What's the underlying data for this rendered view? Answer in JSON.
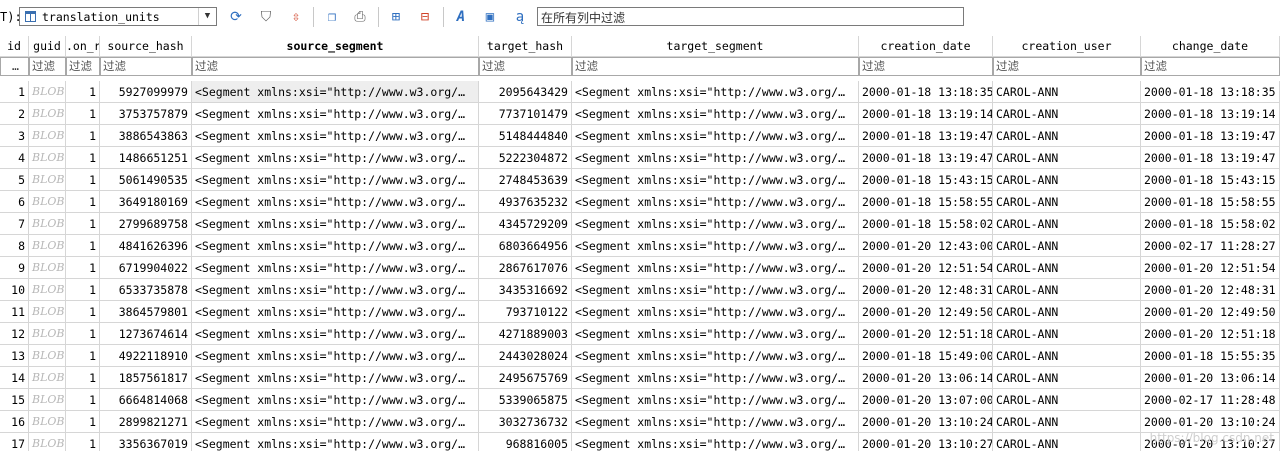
{
  "toolbar": {
    "table_prefix": "T):",
    "table_name": "translation_units",
    "icons": [
      "refresh-icon",
      "filter-icon",
      "clear-filter-icon",
      "copy-table-icon",
      "print-icon",
      "add-row-icon",
      "delete-row-icon",
      "text-format-icon",
      "open-icon",
      "translate-icon"
    ],
    "filter_all_placeholder": "在所有列中过滤"
  },
  "grid": {
    "columns": [
      "id",
      "guid",
      ".on_r",
      "source_hash",
      "source_segment",
      "target_hash",
      "target_segment",
      "creation_date",
      "creation_user",
      "change_date"
    ],
    "filter_placeholder": "过滤",
    "filter_first": "…",
    "rows": [
      {
        "id": "1",
        "guid": "BLOB",
        "on": "1",
        "source_hash": "5927099979",
        "source_segment": "<Segment xmlns:xsi=\"http://www.w3.org/…",
        "target_hash": "2095643429",
        "target_segment": "<Segment xmlns:xsi=\"http://www.w3.org/…",
        "creation_date": "2000-01-18 13:18:35",
        "creation_user": "CAROL-ANN",
        "change_date": "2000-01-18 13:18:35"
      },
      {
        "id": "2",
        "guid": "BLOB",
        "on": "1",
        "source_hash": "3753757879",
        "source_segment": "<Segment xmlns:xsi=\"http://www.w3.org/…",
        "target_hash": "7737101479",
        "target_segment": "<Segment xmlns:xsi=\"http://www.w3.org/…",
        "creation_date": "2000-01-18 13:19:14",
        "creation_user": "CAROL-ANN",
        "change_date": "2000-01-18 13:19:14"
      },
      {
        "id": "3",
        "guid": "BLOB",
        "on": "1",
        "source_hash": "3886543863",
        "source_segment": "<Segment xmlns:xsi=\"http://www.w3.org/…",
        "target_hash": "5148444840",
        "target_segment": "<Segment xmlns:xsi=\"http://www.w3.org/…",
        "creation_date": "2000-01-18 13:19:47",
        "creation_user": "CAROL-ANN",
        "change_date": "2000-01-18 13:19:47"
      },
      {
        "id": "4",
        "guid": "BLOB",
        "on": "1",
        "source_hash": "1486651251",
        "source_segment": "<Segment xmlns:xsi=\"http://www.w3.org/…",
        "target_hash": "5222304872",
        "target_segment": "<Segment xmlns:xsi=\"http://www.w3.org/…",
        "creation_date": "2000-01-18 13:19:47",
        "creation_user": "CAROL-ANN",
        "change_date": "2000-01-18 13:19:47"
      },
      {
        "id": "5",
        "guid": "BLOB",
        "on": "1",
        "source_hash": "5061490535",
        "source_segment": "<Segment xmlns:xsi=\"http://www.w3.org/…",
        "target_hash": "2748453639",
        "target_segment": "<Segment xmlns:xsi=\"http://www.w3.org/…",
        "creation_date": "2000-01-18 15:43:15",
        "creation_user": "CAROL-ANN",
        "change_date": "2000-01-18 15:43:15"
      },
      {
        "id": "6",
        "guid": "BLOB",
        "on": "1",
        "source_hash": "3649180169",
        "source_segment": "<Segment xmlns:xsi=\"http://www.w3.org/…",
        "target_hash": "4937635232",
        "target_segment": "<Segment xmlns:xsi=\"http://www.w3.org/…",
        "creation_date": "2000-01-18 15:58:55",
        "creation_user": "CAROL-ANN",
        "change_date": "2000-01-18 15:58:55"
      },
      {
        "id": "7",
        "guid": "BLOB",
        "on": "1",
        "source_hash": "2799689758",
        "source_segment": "<Segment xmlns:xsi=\"http://www.w3.org/…",
        "target_hash": "4345729209",
        "target_segment": "<Segment xmlns:xsi=\"http://www.w3.org/…",
        "creation_date": "2000-01-18 15:58:02",
        "creation_user": "CAROL-ANN",
        "change_date": "2000-01-18 15:58:02"
      },
      {
        "id": "8",
        "guid": "BLOB",
        "on": "1",
        "source_hash": "4841626396",
        "source_segment": "<Segment xmlns:xsi=\"http://www.w3.org/…",
        "target_hash": "6803664956",
        "target_segment": "<Segment xmlns:xsi=\"http://www.w3.org/…",
        "creation_date": "2000-01-20 12:43:00",
        "creation_user": "CAROL-ANN",
        "change_date": "2000-02-17 11:28:27"
      },
      {
        "id": "9",
        "guid": "BLOB",
        "on": "1",
        "source_hash": "6719904022",
        "source_segment": "<Segment xmlns:xsi=\"http://www.w3.org/…",
        "target_hash": "2867617076",
        "target_segment": "<Segment xmlns:xsi=\"http://www.w3.org/…",
        "creation_date": "2000-01-20 12:51:54",
        "creation_user": "CAROL-ANN",
        "change_date": "2000-01-20 12:51:54"
      },
      {
        "id": "10",
        "guid": "BLOB",
        "on": "1",
        "source_hash": "6533735878",
        "source_segment": "<Segment xmlns:xsi=\"http://www.w3.org/…",
        "target_hash": "3435316692",
        "target_segment": "<Segment xmlns:xsi=\"http://www.w3.org/…",
        "creation_date": "2000-01-20 12:48:31",
        "creation_user": "CAROL-ANN",
        "change_date": "2000-01-20 12:48:31"
      },
      {
        "id": "11",
        "guid": "BLOB",
        "on": "1",
        "source_hash": "3864579801",
        "source_segment": "<Segment xmlns:xsi=\"http://www.w3.org/…",
        "target_hash": "793710122",
        "target_segment": "<Segment xmlns:xsi=\"http://www.w3.org/…",
        "creation_date": "2000-01-20 12:49:50",
        "creation_user": "CAROL-ANN",
        "change_date": "2000-01-20 12:49:50"
      },
      {
        "id": "12",
        "guid": "BLOB",
        "on": "1",
        "source_hash": "1273674614",
        "source_segment": "<Segment xmlns:xsi=\"http://www.w3.org/…",
        "target_hash": "4271889003",
        "target_segment": "<Segment xmlns:xsi=\"http://www.w3.org/…",
        "creation_date": "2000-01-20 12:51:18",
        "creation_user": "CAROL-ANN",
        "change_date": "2000-01-20 12:51:18"
      },
      {
        "id": "13",
        "guid": "BLOB",
        "on": "1",
        "source_hash": "4922118910",
        "source_segment": "<Segment xmlns:xsi=\"http://www.w3.org/…",
        "target_hash": "2443028024",
        "target_segment": "<Segment xmlns:xsi=\"http://www.w3.org/…",
        "creation_date": "2000-01-18 15:49:00",
        "creation_user": "CAROL-ANN",
        "change_date": "2000-01-18 15:55:35"
      },
      {
        "id": "14",
        "guid": "BLOB",
        "on": "1",
        "source_hash": "1857561817",
        "source_segment": "<Segment xmlns:xsi=\"http://www.w3.org/…",
        "target_hash": "2495675769",
        "target_segment": "<Segment xmlns:xsi=\"http://www.w3.org/…",
        "creation_date": "2000-01-20 13:06:14",
        "creation_user": "CAROL-ANN",
        "change_date": "2000-01-20 13:06:14"
      },
      {
        "id": "15",
        "guid": "BLOB",
        "on": "1",
        "source_hash": "6664814068",
        "source_segment": "<Segment xmlns:xsi=\"http://www.w3.org/…",
        "target_hash": "5339065875",
        "target_segment": "<Segment xmlns:xsi=\"http://www.w3.org/…",
        "creation_date": "2000-01-20 13:07:00",
        "creation_user": "CAROL-ANN",
        "change_date": "2000-02-17 11:28:48"
      },
      {
        "id": "16",
        "guid": "BLOB",
        "on": "1",
        "source_hash": "2899821271",
        "source_segment": "<Segment xmlns:xsi=\"http://www.w3.org/…",
        "target_hash": "3032736732",
        "target_segment": "<Segment xmlns:xsi=\"http://www.w3.org/…",
        "creation_date": "2000-01-20 13:10:24",
        "creation_user": "CAROL-ANN",
        "change_date": "2000-01-20 13:10:24"
      },
      {
        "id": "17",
        "guid": "BLOB",
        "on": "1",
        "source_hash": "3356367019",
        "source_segment": "<Segment xmlns:xsi=\"http://www.w3.org/…",
        "target_hash": "968816005",
        "target_segment": "<Segment xmlns:xsi=\"http://www.w3.org/…",
        "creation_date": "2000-01-20 13:10:27",
        "creation_user": "CAROL-ANN",
        "change_date": "2000-01-20 13:10:27"
      }
    ]
  },
  "watermark": "https://blog.csdn.net"
}
